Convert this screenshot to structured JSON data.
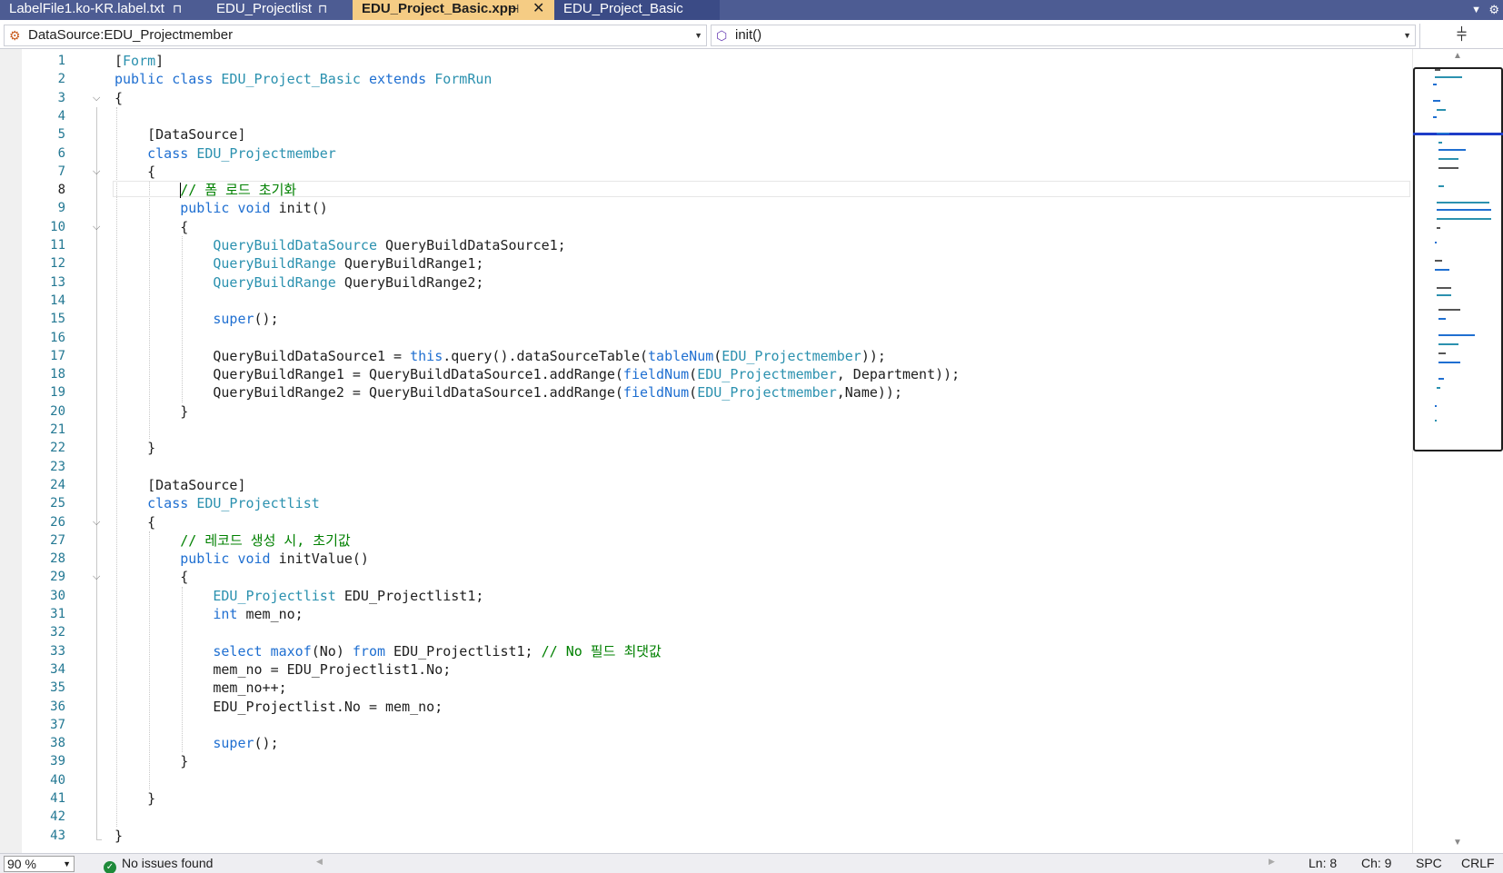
{
  "tabs": [
    {
      "label": "LabelFile1.ko-KR.label.txt",
      "pin": "⊓"
    },
    {
      "label": "EDU_Projectlist",
      "pin": "⊓"
    },
    {
      "label": "EDU_Project_Basic.xpp",
      "pin": "⊣",
      "close": "✕"
    },
    {
      "label": "EDU_Project_Basic"
    }
  ],
  "navbar": {
    "left_label": "DataSource:EDU_Projectmember",
    "right_label": "init()"
  },
  "status": {
    "zoom": "90 %",
    "issues": "No issues found",
    "ln": "Ln: 8",
    "ch": "Ch: 9",
    "spc": "SPC",
    "crlf": "CRLF"
  },
  "colors": {
    "keyword": "#1f6fd1",
    "type": "#2b91af",
    "comment": "#008000",
    "active_tab": "#f5cc84",
    "tabbar": "#4d5c93"
  },
  "icons": [
    "pin-icon",
    "close-icon",
    "class-icon",
    "method-icon",
    "split-icon",
    "check-icon"
  ],
  "code_lines": [
    {
      "n": "1",
      "tokens": [
        [
          "",
          "["
        ],
        [
          "ty",
          "Form"
        ],
        [
          "",
          "]"
        ]
      ]
    },
    {
      "n": "2",
      "tokens": [
        [
          "kw",
          "public"
        ],
        [
          "",
          " "
        ],
        [
          "kw",
          "class"
        ],
        [
          "",
          " "
        ],
        [
          "ty",
          "EDU_Project_Basic"
        ],
        [
          "",
          " "
        ],
        [
          "kw",
          "extends"
        ],
        [
          "",
          " "
        ],
        [
          "ty",
          "FormRun"
        ]
      ]
    },
    {
      "n": "3",
      "tokens": [
        [
          "",
          "{"
        ]
      ]
    },
    {
      "n": "4",
      "tokens": []
    },
    {
      "n": "5",
      "tokens": [
        [
          "",
          "    [DataSource]"
        ]
      ]
    },
    {
      "n": "6",
      "tokens": [
        [
          "",
          "    "
        ],
        [
          "kw",
          "class"
        ],
        [
          "",
          " "
        ],
        [
          "ty",
          "EDU_Projectmember"
        ]
      ]
    },
    {
      "n": "7",
      "tokens": [
        [
          "",
          "    {"
        ]
      ]
    },
    {
      "n": "8",
      "tokens": [
        [
          "",
          "        "
        ],
        [
          "cm",
          "// 폼 로드 초기화"
        ]
      ]
    },
    {
      "n": "9",
      "tokens": [
        [
          "",
          "        "
        ],
        [
          "kw",
          "public"
        ],
        [
          "",
          " "
        ],
        [
          "kw",
          "void"
        ],
        [
          "",
          " init()"
        ]
      ]
    },
    {
      "n": "10",
      "tokens": [
        [
          "",
          "        {"
        ]
      ]
    },
    {
      "n": "11",
      "tokens": [
        [
          "",
          "            "
        ],
        [
          "ty",
          "QueryBuildDataSource"
        ],
        [
          "",
          " QueryBuildDataSource1;"
        ]
      ]
    },
    {
      "n": "12",
      "tokens": [
        [
          "",
          "            "
        ],
        [
          "ty",
          "QueryBuildRange"
        ],
        [
          "",
          " QueryBuildRange1;"
        ]
      ]
    },
    {
      "n": "13",
      "tokens": [
        [
          "",
          "            "
        ],
        [
          "ty",
          "QueryBuildRange"
        ],
        [
          "",
          " QueryBuildRange2;"
        ]
      ]
    },
    {
      "n": "14",
      "tokens": []
    },
    {
      "n": "15",
      "tokens": [
        [
          "",
          "            "
        ],
        [
          "kw",
          "super"
        ],
        [
          "",
          "();"
        ]
      ]
    },
    {
      "n": "16",
      "tokens": []
    },
    {
      "n": "17",
      "tokens": [
        [
          "",
          "            QueryBuildDataSource1 = "
        ],
        [
          "kw",
          "this"
        ],
        [
          "",
          ".query().dataSourceTable("
        ],
        [
          "kw",
          "tableNum"
        ],
        [
          "",
          "("
        ],
        [
          "ty",
          "EDU_Projectmember"
        ],
        [
          "",
          "));"
        ]
      ]
    },
    {
      "n": "18",
      "tokens": [
        [
          "",
          "            QueryBuildRange1 = QueryBuildDataSource1.addRange("
        ],
        [
          "kw",
          "fieldNum"
        ],
        [
          "",
          "("
        ],
        [
          "ty",
          "EDU_Projectmember"
        ],
        [
          "",
          ", Department));"
        ]
      ]
    },
    {
      "n": "19",
      "tokens": [
        [
          "",
          "            QueryBuildRange2 = QueryBuildDataSource1.addRange("
        ],
        [
          "kw",
          "fieldNum"
        ],
        [
          "",
          "("
        ],
        [
          "ty",
          "EDU_Projectmember"
        ],
        [
          "",
          ",Name));"
        ]
      ]
    },
    {
      "n": "20",
      "tokens": [
        [
          "",
          "        }"
        ]
      ]
    },
    {
      "n": "21",
      "tokens": []
    },
    {
      "n": "22",
      "tokens": [
        [
          "",
          "    }"
        ]
      ]
    },
    {
      "n": "23",
      "tokens": []
    },
    {
      "n": "24",
      "tokens": [
        [
          "",
          "    [DataSource]"
        ]
      ]
    },
    {
      "n": "25",
      "tokens": [
        [
          "",
          "    "
        ],
        [
          "kw",
          "class"
        ],
        [
          "",
          " "
        ],
        [
          "ty",
          "EDU_Projectlist"
        ]
      ]
    },
    {
      "n": "26",
      "tokens": [
        [
          "",
          "    {"
        ]
      ]
    },
    {
      "n": "27",
      "tokens": [
        [
          "",
          "        "
        ],
        [
          "cm",
          "// 레코드 생성 시, 초기값"
        ]
      ]
    },
    {
      "n": "28",
      "tokens": [
        [
          "",
          "        "
        ],
        [
          "kw",
          "public"
        ],
        [
          "",
          " "
        ],
        [
          "kw",
          "void"
        ],
        [
          "",
          " initValue()"
        ]
      ]
    },
    {
      "n": "29",
      "tokens": [
        [
          "",
          "        {"
        ]
      ]
    },
    {
      "n": "30",
      "tokens": [
        [
          "",
          "            "
        ],
        [
          "ty",
          "EDU_Projectlist"
        ],
        [
          "",
          " EDU_Projectlist1;"
        ]
      ]
    },
    {
      "n": "31",
      "tokens": [
        [
          "",
          "            "
        ],
        [
          "kw",
          "int"
        ],
        [
          "",
          " mem_no;"
        ]
      ]
    },
    {
      "n": "32",
      "tokens": []
    },
    {
      "n": "33",
      "tokens": [
        [
          "",
          "            "
        ],
        [
          "kw",
          "select"
        ],
        [
          "",
          " "
        ],
        [
          "kw",
          "maxof"
        ],
        [
          "",
          "(No) "
        ],
        [
          "kw",
          "from"
        ],
        [
          "",
          " EDU_Projectlist1; "
        ],
        [
          "cm",
          "// No 필드 최댓값"
        ]
      ]
    },
    {
      "n": "34",
      "tokens": [
        [
          "",
          "            mem_no = EDU_Projectlist1.No;"
        ]
      ]
    },
    {
      "n": "35",
      "tokens": [
        [
          "",
          "            mem_no++;"
        ]
      ]
    },
    {
      "n": "36",
      "tokens": [
        [
          "",
          "            EDU_Projectlist.No = mem_no;"
        ]
      ]
    },
    {
      "n": "37",
      "tokens": []
    },
    {
      "n": "38",
      "tokens": [
        [
          "",
          "            "
        ],
        [
          "kw",
          "super"
        ],
        [
          "",
          "();"
        ]
      ]
    },
    {
      "n": "39",
      "tokens": [
        [
          "",
          "        }"
        ]
      ]
    },
    {
      "n": "40",
      "tokens": []
    },
    {
      "n": "41",
      "tokens": [
        [
          "",
          "    }"
        ]
      ]
    },
    {
      "n": "42",
      "tokens": []
    },
    {
      "n": "43",
      "tokens": [
        [
          "",
          "}"
        ]
      ]
    }
  ],
  "fold_lines": [
    "3",
    "7",
    "10",
    "26",
    "29"
  ],
  "current_line": "8"
}
